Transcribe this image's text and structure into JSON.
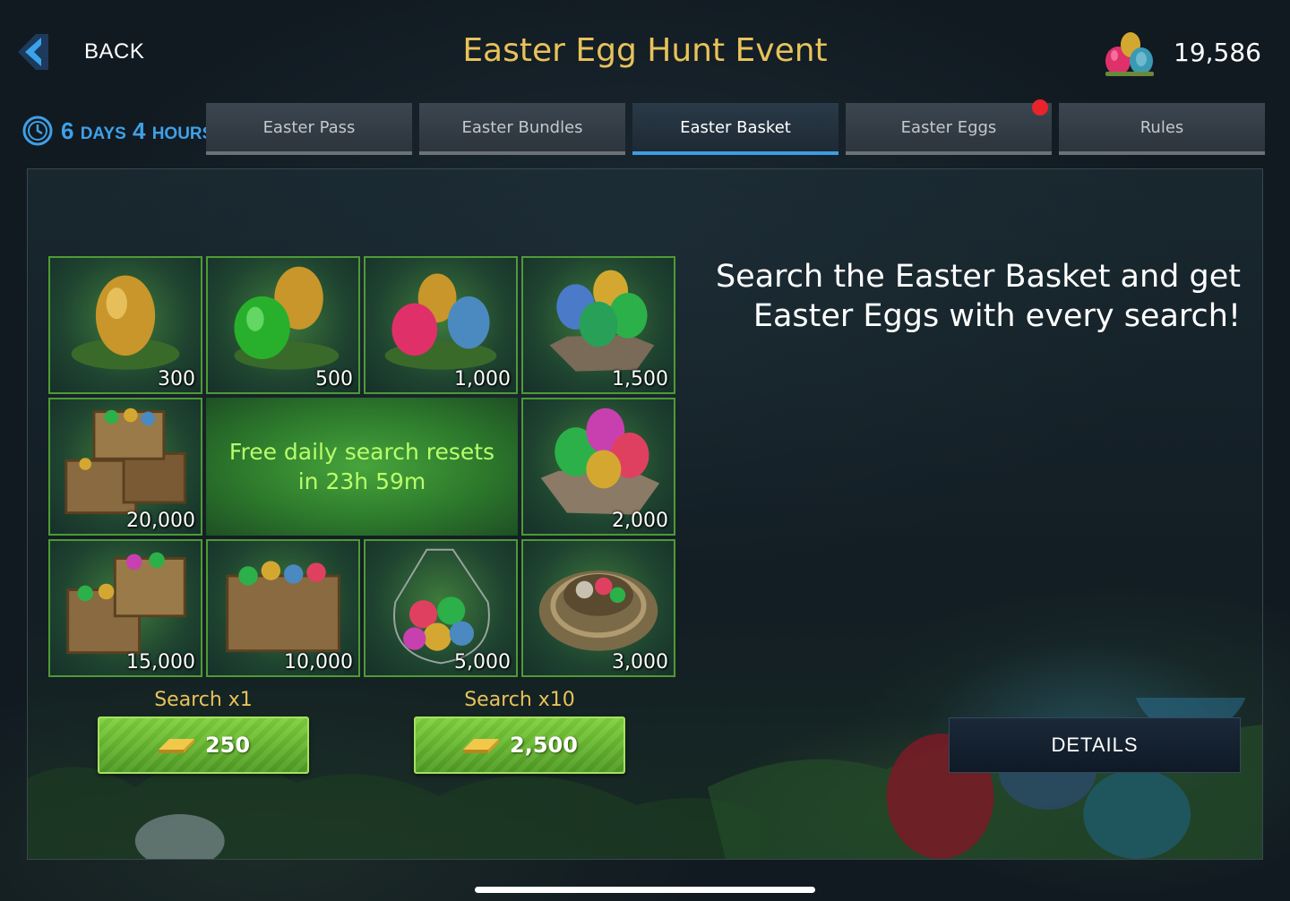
{
  "header": {
    "back_label": "BACK",
    "title": "Easter Egg Hunt Event",
    "currency_value": "19,586",
    "currency_icon": "easter-eggs-icon"
  },
  "timer": {
    "days_num": "6",
    "days_unit": "DAYS",
    "hours_num": "4",
    "hours_unit": "HOURS"
  },
  "tabs": [
    {
      "label": "Easter Pass",
      "active": false
    },
    {
      "label": "Easter Bundles",
      "active": false
    },
    {
      "label": "Easter Basket",
      "active": true
    },
    {
      "label": "Easter Eggs",
      "active": false,
      "notification": true
    },
    {
      "label": "Rules",
      "active": false
    }
  ],
  "rewards": [
    {
      "amount": "300",
      "art": "golden-egg"
    },
    {
      "amount": "500",
      "art": "green-and-gold-eggs"
    },
    {
      "amount": "1,000",
      "art": "three-eggs"
    },
    {
      "amount": "1,500",
      "art": "egg-pile-on-rock"
    },
    {
      "amount": "20,000",
      "art": "stacked-egg-crates"
    },
    {
      "amount": "2,000",
      "art": "egg-pile-on-rock-large"
    },
    {
      "amount": "15,000",
      "art": "two-egg-crates"
    },
    {
      "amount": "10,000",
      "art": "egg-crate"
    },
    {
      "amount": "5,000",
      "art": "egg-net-bag"
    },
    {
      "amount": "3,000",
      "art": "egg-rope-nest"
    }
  ],
  "free_search": {
    "line1": "Free daily search resets",
    "line2": "in 23h 59m"
  },
  "search_x1": {
    "label": "Search x1",
    "cost": "250"
  },
  "search_x10": {
    "label": "Search x10",
    "cost": "2,500"
  },
  "description": {
    "line1": "Search the Easter Basket and get",
    "line2": "Easter Eggs with every search!"
  },
  "details_label": "DETAILS",
  "colors": {
    "title_gold": "#e8c25a",
    "timer_blue": "#3fa0e8",
    "active_tab_underline": "#3e9de0",
    "reward_border": "#4f9a35",
    "free_search_text": "#b8ff6a",
    "button_green": "#6abf33",
    "notification_red": "#e8232b"
  }
}
